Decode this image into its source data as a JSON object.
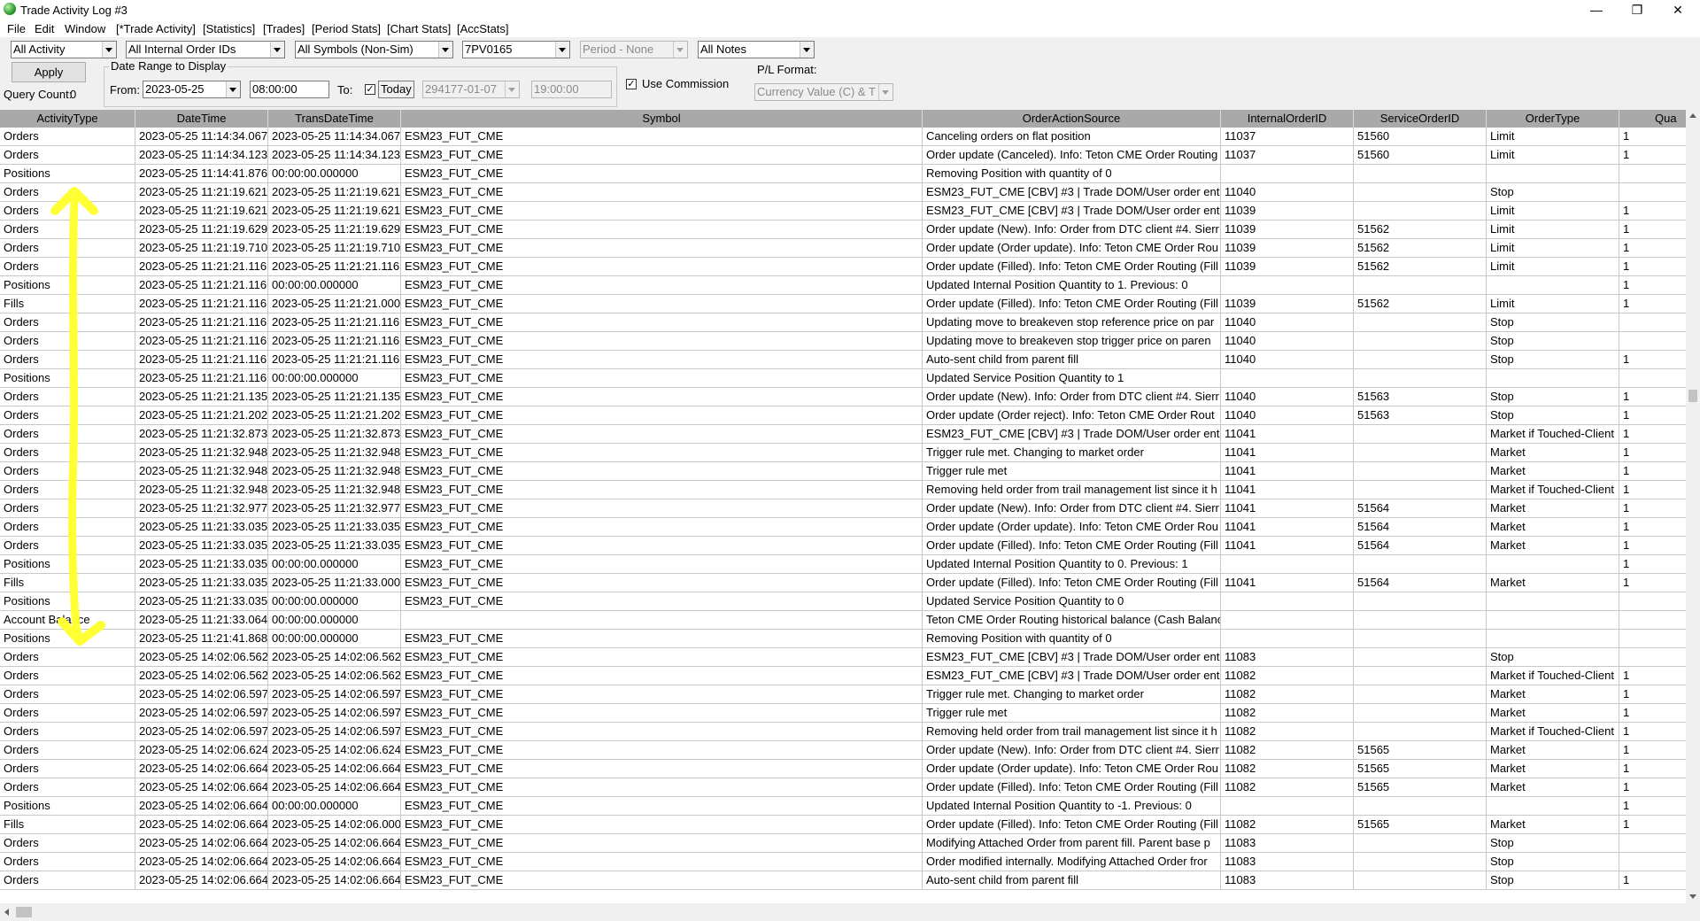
{
  "window": {
    "title": "Trade Activity Log #3",
    "minimize_label": "—",
    "maximize_label": "❐",
    "close_label": "✕"
  },
  "menu": [
    "File",
    "Edit",
    "Window",
    "[*Trade Activity]",
    "[Statistics]",
    "[Trades]",
    "[Period Stats]",
    "[Chart Stats]",
    "[AccStats]"
  ],
  "filters": {
    "activity": "All Activity",
    "order_ids": "All Internal Order IDs",
    "symbols": "All Symbols (Non-Sim)",
    "account": "7PV0165",
    "period": "Period - None",
    "notes": "All Notes"
  },
  "apply_label": "Apply",
  "query_count_label": "Query Count:",
  "query_count": "0",
  "date_range": {
    "label": "Date Range to Display",
    "from_label": "From:",
    "from_date": "2023-05-25",
    "from_time": "08:00:00",
    "to_label": "To:",
    "today_label": "Today",
    "today_checked": true,
    "to_date": "294177-01-07",
    "to_time": "19:00:00"
  },
  "use_commission_label": "Use Commission",
  "use_commission_checked": true,
  "pl_format": {
    "label": "P/L Format:",
    "value": "Currency Value (C) & T"
  },
  "columns": [
    "ActivityType",
    "DateTime",
    "TransDateTime",
    "Symbol",
    "OrderActionSource",
    "InternalOrderID",
    "ServiceOrderID",
    "OrderType",
    "Qua"
  ],
  "rows": [
    [
      "Orders",
      "2023-05-25  11:14:34.067",
      "2023-05-25  11:14:34.067",
      "ESM23_FUT_CME",
      "Canceling orders on flat position",
      "11037",
      "51560",
      "Limit",
      "1"
    ],
    [
      "Orders",
      "2023-05-25  11:14:34.123",
      "2023-05-25  11:14:34.123",
      "ESM23_FUT_CME",
      "Order update (Canceled). Info: Teton CME Order Routing",
      "11037",
      "51560",
      "Limit",
      "1"
    ],
    [
      "Positions",
      "2023-05-25  11:14:41.876",
      "00:00:00.000000",
      "ESM23_FUT_CME",
      "Removing Position with quantity of 0",
      "",
      "",
      "",
      ""
    ],
    [
      "Orders",
      "2023-05-25  11:21:19.621",
      "2023-05-25  11:21:19.621",
      "ESM23_FUT_CME",
      "ESM23_FUT_CME [CBV]  #3 | Trade DOM/User order entr",
      "11040",
      "",
      "Stop",
      ""
    ],
    [
      "Orders",
      "2023-05-25  11:21:19.621",
      "2023-05-25  11:21:19.621",
      "ESM23_FUT_CME",
      "ESM23_FUT_CME [CBV]  #3 | Trade DOM/User order entr",
      "11039",
      "",
      "Limit",
      "1"
    ],
    [
      "Orders",
      "2023-05-25  11:21:19.629",
      "2023-05-25  11:21:19.629",
      "ESM23_FUT_CME",
      "Order update (New). Info: Order from DTC client #4. Sierr",
      "11039",
      "51562",
      "Limit",
      "1"
    ],
    [
      "Orders",
      "2023-05-25  11:21:19.710",
      "2023-05-25  11:21:19.710",
      "ESM23_FUT_CME",
      "Order update (Order update). Info: Teton CME Order Rou",
      "11039",
      "51562",
      "Limit",
      "1"
    ],
    [
      "Orders",
      "2023-05-25  11:21:21.116",
      "2023-05-25  11:21:21.116",
      "ESM23_FUT_CME",
      "Order update (Filled). Info: Teton CME Order Routing (Fill",
      "11039",
      "51562",
      "Limit",
      "1"
    ],
    [
      "Positions",
      "2023-05-25  11:21:21.116",
      "00:00:00.000000",
      "ESM23_FUT_CME",
      "Updated Internal Position Quantity to 1. Previous: 0",
      "",
      "",
      "",
      "1"
    ],
    [
      "Fills",
      "2023-05-25  11:21:21.116",
      "2023-05-25  11:21:21.000",
      "ESM23_FUT_CME",
      "Order update (Filled). Info: Teton CME Order Routing (Fill",
      "11039",
      "51562",
      "Limit",
      "1"
    ],
    [
      "Orders",
      "2023-05-25  11:21:21.116",
      "2023-05-25  11:21:21.116",
      "ESM23_FUT_CME",
      "Updating move to breakeven stop reference price on par",
      "11040",
      "",
      "Stop",
      ""
    ],
    [
      "Orders",
      "2023-05-25  11:21:21.116",
      "2023-05-25  11:21:21.116",
      "ESM23_FUT_CME",
      "Updating move to breakeven stop trigger price on paren",
      "11040",
      "",
      "Stop",
      ""
    ],
    [
      "Orders",
      "2023-05-25  11:21:21.116",
      "2023-05-25  11:21:21.116",
      "ESM23_FUT_CME",
      "Auto-sent child from parent fill",
      "11040",
      "",
      "Stop",
      "1"
    ],
    [
      "Positions",
      "2023-05-25  11:21:21.116",
      "00:00:00.000000",
      "ESM23_FUT_CME",
      "Updated Service Position Quantity to 1",
      "",
      "",
      "",
      ""
    ],
    [
      "Orders",
      "2023-05-25  11:21:21.135",
      "2023-05-25  11:21:21.135",
      "ESM23_FUT_CME",
      "Order update (New). Info: Order from DTC client #4. Sierr",
      "11040",
      "51563",
      "Stop",
      "1"
    ],
    [
      "Orders",
      "2023-05-25  11:21:21.202",
      "2023-05-25  11:21:21.202",
      "ESM23_FUT_CME",
      "Order update (Order reject). Info: Teton CME Order Rout",
      "11040",
      "51563",
      "Stop",
      "1"
    ],
    [
      "Orders",
      "2023-05-25  11:21:32.873",
      "2023-05-25  11:21:32.873",
      "ESM23_FUT_CME",
      "ESM23_FUT_CME [CBV]  #3 | Trade DOM/User order entr",
      "11041",
      "",
      "Market if Touched-Client",
      "1"
    ],
    [
      "Orders",
      "2023-05-25  11:21:32.948",
      "2023-05-25  11:21:32.948",
      "ESM23_FUT_CME",
      "Trigger rule met. Changing to market order",
      "11041",
      "",
      "Market",
      "1"
    ],
    [
      "Orders",
      "2023-05-25  11:21:32.948",
      "2023-05-25  11:21:32.948",
      "ESM23_FUT_CME",
      "Trigger rule met",
      "11041",
      "",
      "Market",
      "1"
    ],
    [
      "Orders",
      "2023-05-25  11:21:32.948",
      "2023-05-25  11:21:32.948",
      "ESM23_FUT_CME",
      "Removing held order from trail management list since it h",
      "11041",
      "",
      "Market if Touched-Client",
      "1"
    ],
    [
      "Orders",
      "2023-05-25  11:21:32.977",
      "2023-05-25  11:21:32.977",
      "ESM23_FUT_CME",
      "Order update (New). Info: Order from DTC client #4. Sierr",
      "11041",
      "51564",
      "Market",
      "1"
    ],
    [
      "Orders",
      "2023-05-25  11:21:33.035",
      "2023-05-25  11:21:33.035",
      "ESM23_FUT_CME",
      "Order update (Order update). Info: Teton CME Order Rou",
      "11041",
      "51564",
      "Market",
      "1"
    ],
    [
      "Orders",
      "2023-05-25  11:21:33.035",
      "2023-05-25  11:21:33.035",
      "ESM23_FUT_CME",
      "Order update (Filled). Info: Teton CME Order Routing (Fill",
      "11041",
      "51564",
      "Market",
      "1"
    ],
    [
      "Positions",
      "2023-05-25  11:21:33.035",
      "00:00:00.000000",
      "ESM23_FUT_CME",
      "Updated Internal Position Quantity to 0. Previous: 1",
      "",
      "",
      "",
      "1"
    ],
    [
      "Fills",
      "2023-05-25  11:21:33.035",
      "2023-05-25  11:21:33.000",
      "ESM23_FUT_CME",
      "Order update (Filled). Info: Teton CME Order Routing (Fill",
      "11041",
      "51564",
      "Market",
      "1"
    ],
    [
      "Positions",
      "2023-05-25  11:21:33.035",
      "00:00:00.000000",
      "ESM23_FUT_CME",
      "Updated Service Position Quantity to 0",
      "",
      "",
      "",
      ""
    ],
    [
      "Account Balance",
      "2023-05-25  11:21:33.064",
      "00:00:00.000000",
      "",
      "Teton CME Order Routing historical balance (Cash Balanc",
      "",
      "",
      "",
      ""
    ],
    [
      "Positions",
      "2023-05-25  11:21:41.868",
      "00:00:00.000000",
      "ESM23_FUT_CME",
      "Removing Position with quantity of 0",
      "",
      "",
      "",
      ""
    ],
    [
      "Orders",
      "2023-05-25  14:02:06.562",
      "2023-05-25  14:02:06.562",
      "ESM23_FUT_CME",
      "ESM23_FUT_CME [CBV]  #3 | Trade DOM/User order entr",
      "11083",
      "",
      "Stop",
      ""
    ],
    [
      "Orders",
      "2023-05-25  14:02:06.562",
      "2023-05-25  14:02:06.562",
      "ESM23_FUT_CME",
      "ESM23_FUT_CME [CBV]  #3 | Trade DOM/User order entr",
      "11082",
      "",
      "Market if Touched-Client",
      "1"
    ],
    [
      "Orders",
      "2023-05-25  14:02:06.597",
      "2023-05-25  14:02:06.597",
      "ESM23_FUT_CME",
      "Trigger rule met. Changing to market order",
      "11082",
      "",
      "Market",
      "1"
    ],
    [
      "Orders",
      "2023-05-25  14:02:06.597",
      "2023-05-25  14:02:06.597",
      "ESM23_FUT_CME",
      "Trigger rule met",
      "11082",
      "",
      "Market",
      "1"
    ],
    [
      "Orders",
      "2023-05-25  14:02:06.597",
      "2023-05-25  14:02:06.597",
      "ESM23_FUT_CME",
      "Removing held order from trail management list since it h",
      "11082",
      "",
      "Market if Touched-Client",
      "1"
    ],
    [
      "Orders",
      "2023-05-25  14:02:06.624",
      "2023-05-25  14:02:06.624",
      "ESM23_FUT_CME",
      "Order update (New). Info: Order from DTC client #4. Sierr",
      "11082",
      "51565",
      "Market",
      "1"
    ],
    [
      "Orders",
      "2023-05-25  14:02:06.664",
      "2023-05-25  14:02:06.664",
      "ESM23_FUT_CME",
      "Order update (Order update). Info: Teton CME Order Rou",
      "11082",
      "51565",
      "Market",
      "1"
    ],
    [
      "Orders",
      "2023-05-25  14:02:06.664",
      "2023-05-25  14:02:06.664",
      "ESM23_FUT_CME",
      "Order update (Filled). Info: Teton CME Order Routing (Fill",
      "11082",
      "51565",
      "Market",
      "1"
    ],
    [
      "Positions",
      "2023-05-25  14:02:06.664",
      "00:00:00.000000",
      "ESM23_FUT_CME",
      "Updated Internal Position Quantity to -1. Previous: 0",
      "",
      "",
      "",
      "1"
    ],
    [
      "Fills",
      "2023-05-25  14:02:06.664",
      "2023-05-25  14:02:06.000",
      "ESM23_FUT_CME",
      "Order update (Filled). Info: Teton CME Order Routing (Fill",
      "11082",
      "51565",
      "Market",
      "1"
    ],
    [
      "Orders",
      "2023-05-25  14:02:06.664",
      "2023-05-25  14:02:06.664",
      "ESM23_FUT_CME",
      "Modifying Attached Order from parent fill. Parent base p",
      "11083",
      "",
      "Stop",
      ""
    ],
    [
      "Orders",
      "2023-05-25  14:02:06.664",
      "2023-05-25  14:02:06.664",
      "ESM23_FUT_CME",
      "Order modified internally. Modifying Attached Order fror",
      "11083",
      "",
      "Stop",
      ""
    ],
    [
      "Orders",
      "2023-05-25  14:02:06.664",
      "2023-05-25  14:02:06.664",
      "ESM23_FUT_CME",
      "Auto-sent child from parent fill",
      "11083",
      "",
      "Stop",
      "1"
    ]
  ],
  "colors": {
    "header_bg": "#a9a9a9",
    "annotation": "#ffff33"
  },
  "annotation_icon": "double-headed-arrow-icon"
}
